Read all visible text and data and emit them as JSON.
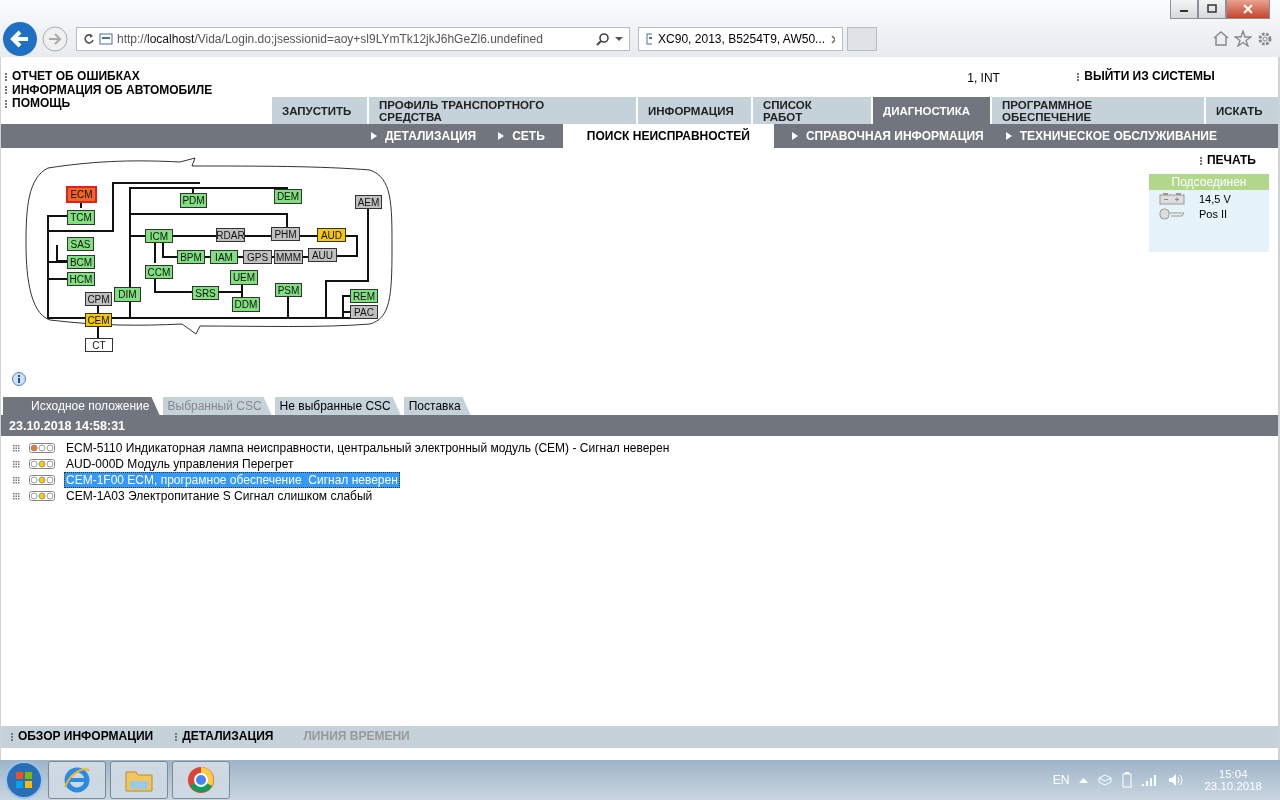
{
  "browser": {
    "url": "http://**localhost**/Vida/Login.do;jsessionid=aoy+sl9LYmTk12jkJ6hGeZl6.undefined",
    "tab_title": "XC90, 2013, B5254T9, AW50..."
  },
  "header_links": [
    "ОТЧЕТ ОБ ОШИБКАХ",
    "ИНФОРМАЦИЯ ОБ АВТОМОБИЛЕ",
    "ПОМОЩЬ"
  ],
  "user": "1, INT",
  "logout": "ВЫЙТИ ИЗ СИСТЕМЫ",
  "main_tabs": [
    {
      "label": "ЗАПУСТИТЬ",
      "selected": false
    },
    {
      "label": "ПРОФИЛЬ ТРАНСПОРТНОГО СРЕДСТВА",
      "selected": false
    },
    {
      "label": "ИНФОРМАЦИЯ",
      "selected": false
    },
    {
      "label": "СПИСОК РАБОТ",
      "selected": false
    },
    {
      "label": "ДИАГНОСТИКА",
      "selected": true
    },
    {
      "label": "ПРОГРАММНОЕ ОБЕСПЕЧЕНИЕ",
      "selected": false
    },
    {
      "label": "ИСКАТЬ",
      "selected": false
    }
  ],
  "sub_tabs": [
    {
      "label": "ДЕТАЛИЗАЦИЯ",
      "selected": false
    },
    {
      "label": "СЕТЬ",
      "selected": false
    },
    {
      "label": "ПОИСК НЕИСПРАВНОСТЕЙ",
      "selected": true
    },
    {
      "label": "СПРАВОЧНАЯ ИНФОРМАЦИЯ",
      "selected": false
    },
    {
      "label": "ТЕХНИЧЕСКОЕ ОБСЛУЖИВАНИЕ",
      "selected": false
    }
  ],
  "print": "ПЕЧАТЬ",
  "connection": {
    "status": "Подсоединен",
    "voltage": "14,5 V",
    "ignition": "Pos II"
  },
  "network": {
    "modules": [
      {
        "label": "ECM",
        "color": "#f26522"
      },
      {
        "label": "PDM",
        "color": "#80e080"
      },
      {
        "label": "DEM",
        "color": "#80e080"
      },
      {
        "label": "AEM",
        "color": "#c0c0c0"
      },
      {
        "label": "TCM",
        "color": "#80e080"
      },
      {
        "label": "SAS",
        "color": "#80e080"
      },
      {
        "label": "ICM",
        "color": "#80e080"
      },
      {
        "label": "RDAR",
        "color": "#c0c0c0"
      },
      {
        "label": "PHM",
        "color": "#c0c0c0"
      },
      {
        "label": "AUD",
        "color": "#f5c800"
      },
      {
        "label": "BCM",
        "color": "#80e080"
      },
      {
        "label": "BPM",
        "color": "#80e080"
      },
      {
        "label": "IAM",
        "color": "#80e080"
      },
      {
        "label": "GPS",
        "color": "#c0c0c0"
      },
      {
        "label": "MMM",
        "color": "#c0c0c0"
      },
      {
        "label": "AUU",
        "color": "#c0c0c0"
      },
      {
        "label": "HCM",
        "color": "#80e080"
      },
      {
        "label": "CCM",
        "color": "#80e080"
      },
      {
        "label": "UEM",
        "color": "#80e080"
      },
      {
        "label": "CPM",
        "color": "#c0c0c0"
      },
      {
        "label": "DIM",
        "color": "#80e080"
      },
      {
        "label": "SRS",
        "color": "#80e080"
      },
      {
        "label": "DDM",
        "color": "#80e080"
      },
      {
        "label": "PSM",
        "color": "#80e080"
      },
      {
        "label": "REM",
        "color": "#80e080"
      },
      {
        "label": "CEM",
        "color": "#f5c800"
      },
      {
        "label": "PAC",
        "color": "#c0c0c0"
      },
      {
        "label": "CT",
        "color": "#ffffff"
      }
    ]
  },
  "fault_tabs": [
    {
      "label": "Исходное положение",
      "selected": true,
      "disabled": false
    },
    {
      "label": "Выбранный CSC",
      "selected": false,
      "disabled": true
    },
    {
      "label": "Не выбранные CSC",
      "selected": false,
      "disabled": false
    },
    {
      "label": "Поставка",
      "selected": false,
      "disabled": false
    }
  ],
  "session_time": "23.10.2018 14:58:31",
  "faults": [
    {
      "text": "ECM-5110 Индикаторная лампа неисправности, центральный электронный модуль (CEM) - Сигнал неверен",
      "kind": "fault",
      "selected": false
    },
    {
      "text": "AUD-000D Модуль управления Перегрет",
      "kind": "warning",
      "selected": false
    },
    {
      "text": "CEM-1F00 ECM, програмное обеспечение  Сигнал неверен",
      "kind": "warning",
      "selected": true
    },
    {
      "text": "CEM-1A03 Электропитание S Сигнал слишком слабый",
      "kind": "warning",
      "selected": false
    }
  ],
  "bottom_links": [
    {
      "label": "ОБЗОР ИНФОРМАЦИИ",
      "disabled": false
    },
    {
      "label": "ДЕТАЛИЗАЦИЯ",
      "disabled": false
    },
    {
      "label": "ЛИНИЯ ВРЕМЕНИ",
      "disabled": true
    }
  ],
  "taskbar": {
    "language": "EN",
    "time": "15:04",
    "date": "23.10.2018"
  }
}
